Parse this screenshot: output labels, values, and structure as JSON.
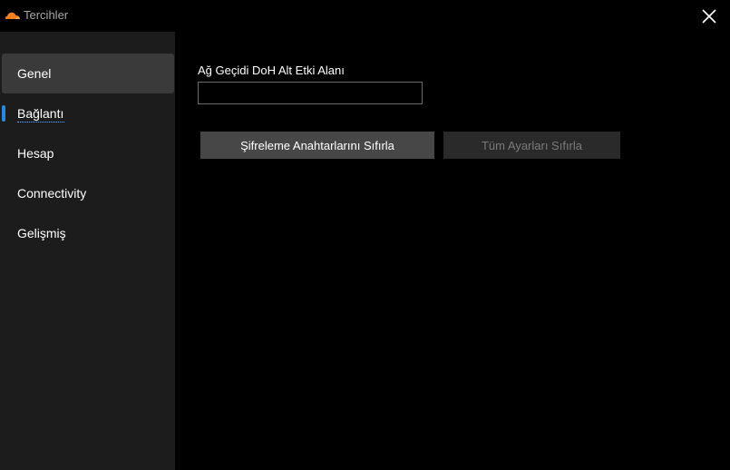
{
  "window": {
    "title": "Tercihler",
    "logo_icon": "cloudflare-cloud-icon",
    "close_icon": "close-icon"
  },
  "sidebar": {
    "items": [
      {
        "label": "Genel"
      },
      {
        "label": "Bağlantı"
      },
      {
        "label": "Hesap"
      },
      {
        "label": "Connectivity"
      },
      {
        "label": "Gelişmiş"
      }
    ]
  },
  "main": {
    "doh_subdomain": {
      "label": "Ağ Geçidi DoH Alt Etki Alanı",
      "value": "",
      "placeholder": ""
    },
    "reset_keys_label": "Şifreleme Anahtarlarını Sıfırla",
    "reset_all_label": "Tüm Ayarları Sıfırla"
  },
  "colors": {
    "accent": "#2b87d8",
    "logo_orange": "#f38020",
    "background": "#000000",
    "sidebar": "#1c1c1c"
  }
}
